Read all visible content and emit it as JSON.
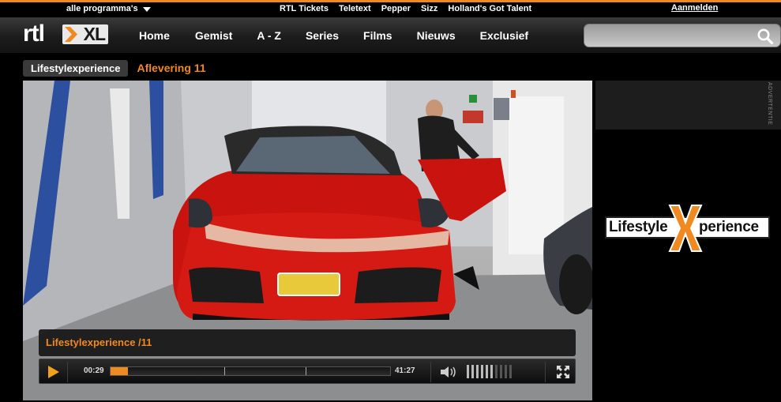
{
  "topbar": {
    "programs_label": "alle programma's",
    "links": [
      "RTL Tickets",
      "Teletext",
      "Pepper",
      "Sizz",
      "Holland's Got Talent"
    ],
    "login_label": "Aanmelden"
  },
  "logo": {
    "rtl": "rtl",
    "xl": "XL"
  },
  "nav": {
    "items": [
      "Home",
      "Gemist",
      "A - Z",
      "Series",
      "Films",
      "Nieuws",
      "Exclusief"
    ]
  },
  "search": {
    "placeholder": "",
    "icon": "search-icon"
  },
  "breadcrumb": {
    "program": "Lifestylexperience",
    "episode": "Aflevering 11"
  },
  "player": {
    "title": "Lifestylexperience /11",
    "current_time": "00:29",
    "duration": "41:27",
    "progress": 0.04,
    "volume_level": 0.6,
    "icons": [
      "play-icon",
      "volume-icon",
      "fullscreen-icon"
    ]
  },
  "ad": {
    "label": "ADVERTENTIE",
    "logo_text_left": "Lifestyle",
    "logo_text_right": "perience"
  },
  "colors": {
    "accent": "#f0891f",
    "background": "#000000",
    "bar": "#2a2a2a"
  }
}
